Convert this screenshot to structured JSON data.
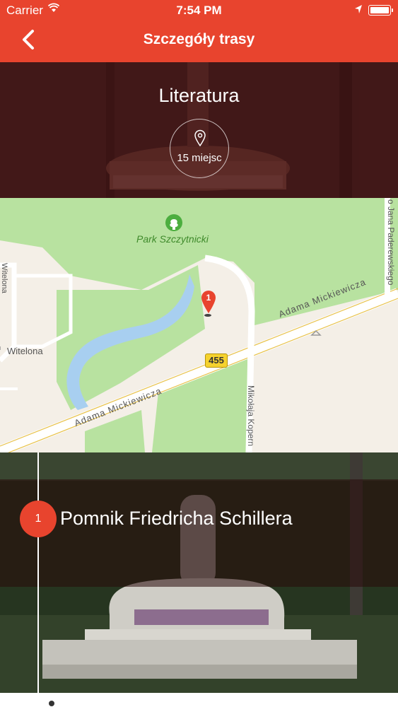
{
  "status_bar": {
    "carrier": "Carrier",
    "time": "7:54 PM"
  },
  "nav": {
    "title": "Szczegóły trasy",
    "back_icon": "chevron-left-icon"
  },
  "route": {
    "title": "Literatura",
    "places_count": "15 miejsc",
    "pin_icon": "map-pin-icon"
  },
  "map": {
    "park_label": "Park Szczytnicki",
    "street_top": "Adama Mickiewicza",
    "street_bottom": "Adama Mickiewicza",
    "street_vertical": "Mikołaja Kopern",
    "street_right": "o Jana Paderewskiego",
    "street_left": "Witelona",
    "street_left_vertical": "Witelona",
    "road_number": "455",
    "marker_number": "1"
  },
  "places": [
    {
      "number": "1",
      "name": "Pomnik Friedricha Schillera"
    }
  ],
  "colors": {
    "accent": "#e8442e",
    "park_green": "#b8e2a0",
    "water": "#a8cff0"
  }
}
